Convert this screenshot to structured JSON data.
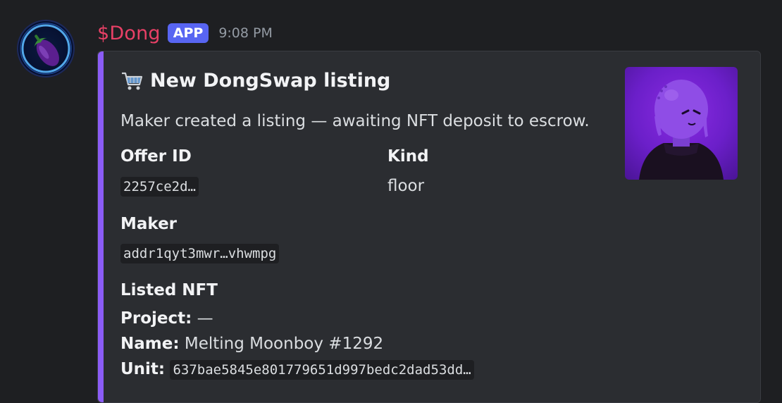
{
  "message": {
    "author": "$Dong",
    "badge": "APP",
    "timestamp": "9:08 PM"
  },
  "embed": {
    "title": "New DongSwap listing",
    "title_icon": "shopping-cart-icon",
    "description": "Maker created a listing — awaiting NFT deposit to escrow.",
    "accent_color": "#8b5cf6",
    "fields": {
      "offer_id": {
        "name": "Offer ID",
        "value": "2257ce2d…"
      },
      "kind": {
        "name": "Kind",
        "value": "floor"
      },
      "maker": {
        "name": "Maker",
        "value": "addr1qyt3mwr…vhwmpg"
      }
    },
    "listed_nft": {
      "heading": "Listed NFT",
      "project_label": "Project:",
      "project_value": "—",
      "name_label": "Name:",
      "name_value": "Melting Moonboy #1292",
      "unit_label": "Unit:",
      "unit_value": "637bae5845e801779651d997bedc2dad53dd…"
    }
  }
}
